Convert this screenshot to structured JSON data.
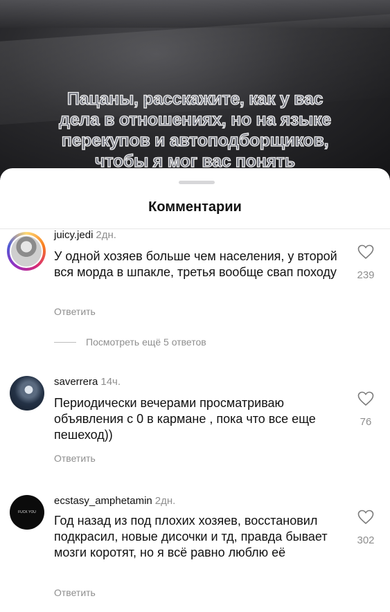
{
  "video": {
    "caption_lines": [
      "Пацаны, расскажите, как у вас",
      "дела в отношениях, но на языке",
      "перекупов и автоподборщиков,",
      "чтобы я мог вас понять"
    ]
  },
  "sheet": {
    "title": "Комментарии"
  },
  "comments": [
    {
      "username": "juicy.jedi",
      "time": "2дн.",
      "text": "У одной хозяев больше чем населения, у второй вся морда в шпакле, третья вообще свап походу",
      "reply_label": "Ответить",
      "likes": "239",
      "more_replies": "Посмотреть ещё 5 ответов"
    },
    {
      "username": "saverrera",
      "time": "14ч.",
      "text": "Периодически вечерами просматриваю объявления с 0 в кармане , пока что все еще пешеход))",
      "reply_label": "Ответить",
      "likes": "76"
    },
    {
      "username": "ecstasy_amphetamin",
      "time": "2дн.",
      "text": "Год назад из под плохих хозяев, восстановил подкрасил, новые дисочки и тд, правда бывает мозги коротят, но я всё равно люблю её",
      "reply_label": "Ответить",
      "likes": "302",
      "avatar_text": "FUCK YOU"
    }
  ]
}
